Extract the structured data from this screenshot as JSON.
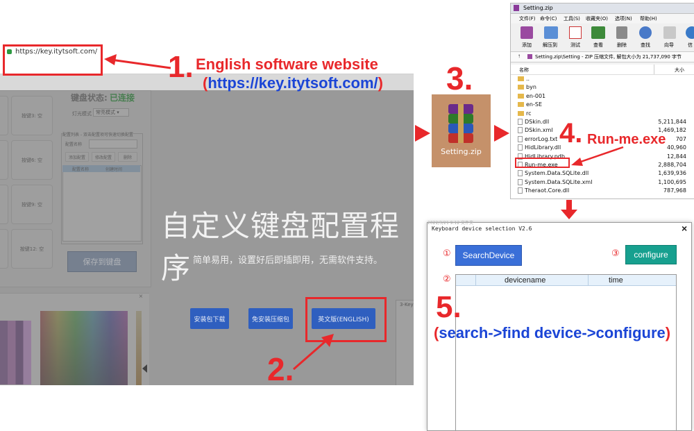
{
  "browser": {
    "url": "https://key.itytsoft.com/"
  },
  "old_app": {
    "keyboard_status_label": "键盘状态:",
    "keyboard_status_value": "已连接",
    "light_mode_label": "灯光模式",
    "light_mode_value": "常亮模式",
    "config_list_label": "配置列表 - 双击配置项可快速切换配置",
    "config_name_label": "配置名称",
    "btn_add": "添加配置",
    "btn_modify": "修改配置",
    "btn_delete": "删除",
    "col_name": "配置名称",
    "col_time": "创建时间",
    "keys": [
      "按键3: 空",
      "按键6: 空",
      "按键9: 空",
      "按键12: 空"
    ],
    "save_button": "保存到键盘",
    "side_tab": "3-Key"
  },
  "hero": {
    "title": "自定义键盘配置程序",
    "subtitle": "简单易用，设置好后即插即用，无需软件支持。",
    "buttons": [
      "安装包下载",
      "免安装压缩包",
      "英文版(ENGLISH)"
    ]
  },
  "steps": {
    "s1_num": "1.",
    "s1_text": "English software website",
    "s1_url": "(https://key.itytsoft.com/)",
    "s2_num": "2.",
    "s3_num": "3.",
    "s4_num": "4.",
    "s4_text": "Run-me.exe",
    "s5_num": "5.",
    "s5_text": "(search->find device->configure)"
  },
  "zip_icon": {
    "label": "Setting.zip"
  },
  "zip_window": {
    "title": "Setting.zip",
    "menu": [
      "文件(F)",
      "命令(C)",
      "工具(S)",
      "收藏夹(O)",
      "选项(N)",
      "帮助(H)"
    ],
    "toolbar": [
      "添加",
      "解压到",
      "测试",
      "查看",
      "删除",
      "查找",
      "向导",
      "信"
    ],
    "path": "Setting.zip\\Setting - ZIP 压缩文件, 解包大小为 21,737,090 字节",
    "col_name": "名称",
    "col_size": "大小",
    "files": [
      {
        "name": "..",
        "size": "",
        "type": "folder"
      },
      {
        "name": "byn",
        "size": "",
        "type": "folder"
      },
      {
        "name": "en-001",
        "size": "",
        "type": "folder"
      },
      {
        "name": "en-SE",
        "size": "",
        "type": "folder"
      },
      {
        "name": "rc",
        "size": "",
        "type": "folder"
      },
      {
        "name": "DSkin.dll",
        "size": "5,211,844",
        "type": "file"
      },
      {
        "name": "DSkin.xml",
        "size": "1,469,182",
        "type": "file"
      },
      {
        "name": "errorLog.txt",
        "size": "707",
        "type": "file"
      },
      {
        "name": "HidLibrary.dll",
        "size": "40,960",
        "type": "file"
      },
      {
        "name": "HidLibrary.pdb",
        "size": "12,844",
        "type": "file"
      },
      {
        "name": "Run-me.exe",
        "size": "2,888,704",
        "type": "file"
      },
      {
        "name": "System.Data.SQLite.dll",
        "size": "1,639,936",
        "type": "file"
      },
      {
        "name": "System.Data.SQLite.xml",
        "size": "1,100,695",
        "type": "file"
      },
      {
        "name": "Theraot.Core.dll",
        "size": "787,968",
        "type": "file"
      }
    ]
  },
  "device_window": {
    "title": "Keyboard device selection V2.6",
    "close": "×",
    "mark1": "①",
    "mark2": "②",
    "mark3": "③",
    "search_button": "SearchDevice",
    "configure_button": "configure",
    "col_devicename": "devicename",
    "col_time": "time",
    "behind_text": "2022/3/21 9:12      文件夹"
  },
  "colors": {
    "red": "#e8282b",
    "blue_text": "#1b45d6",
    "search_btn": "#3a6fd8",
    "configure_btn": "#17a08f"
  }
}
